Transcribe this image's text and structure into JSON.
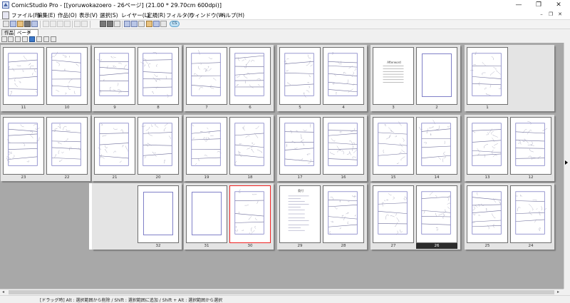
{
  "window": {
    "title": "ComicStudio Pro - [[yoruwokazoero - 26ページ] (21.00 * 29.70cm 600dpi)]",
    "minimize_glyph": "—",
    "maximize_glyph": "❐",
    "close_glyph": "✕"
  },
  "menu": {
    "items": [
      "ファイル(F)",
      "編集(E)",
      "作品(O)",
      "表示(V)",
      "選択(S)",
      "レイヤー(L)",
      "定規(R)",
      "フィルタ(I)",
      "ウィンドウ(W)",
      "ヘルプ(H)"
    ],
    "mdi_minimize": "–",
    "mdi_restore": "❐",
    "mdi_close": "✕"
  },
  "toolbar": {
    "icons": [
      "new-icon",
      "open-icon",
      "save-icon",
      "print-icon",
      "cut-icon",
      "copy-icon",
      "paste-icon",
      "undo-icon",
      "redo-icon",
      "page-view-icon",
      "layer-icon",
      "ruler-icon",
      "zoom-icon",
      "grid-icon",
      "palette-icon",
      "settings-icon"
    ],
    "pill_label": "CS"
  },
  "tabs": [
    {
      "label": "作品",
      "active": false
    },
    {
      "label": "ページ",
      "active": true,
      "close": "✕"
    }
  ],
  "viewtools": {
    "icons": [
      "rotate-left-icon",
      "rotate-right-icon",
      "play-icon",
      "pointer-icon",
      "hand-icon",
      "zoom-tool-icon",
      "fit-icon",
      "layout-icon"
    ]
  },
  "pages": {
    "row1": [
      "11",
      "10",
      "9",
      "8",
      "7",
      "6",
      "5",
      "4",
      "3",
      "2",
      "1"
    ],
    "row2": [
      "23",
      "22",
      "21",
      "20",
      "19",
      "18",
      "17",
      "16",
      "15",
      "14",
      "13",
      "12"
    ],
    "row3": [
      "32",
      "31",
      "30",
      "29",
      "28",
      "27",
      "26",
      "25",
      "24"
    ],
    "selected_page": "30",
    "current_page": "26",
    "afterword_title": "Afterword",
    "credits_title": "奥付"
  },
  "status": {
    "text": "[ドラッグ時] Alt : 選択範囲から削除 / Shift : 選択範囲に追加 / Shift + Alt : 選択範囲から選択"
  },
  "scroll": {
    "left_arrow": "◂",
    "right_arrow": "▸"
  }
}
